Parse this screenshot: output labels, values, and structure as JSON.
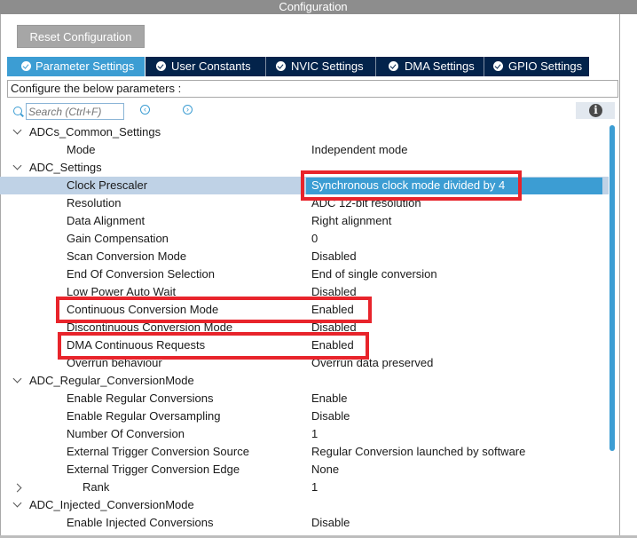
{
  "window": {
    "title": "Configuration"
  },
  "toolbar": {
    "reset_label": "Reset Configuration"
  },
  "tabs": [
    {
      "label": "Parameter Settings",
      "active": true
    },
    {
      "label": "User Constants",
      "active": false
    },
    {
      "label": "NVIC Settings",
      "active": false
    },
    {
      "label": "DMA Settings",
      "active": false
    },
    {
      "label": "GPIO Settings",
      "active": false
    }
  ],
  "configure_text": "Configure the below parameters :",
  "search": {
    "placeholder": "Search (Ctrl+F)"
  },
  "colors": {
    "accent": "#3c9dd3",
    "tab_bar": "#03234b",
    "highlight": "#e8242b",
    "selected_row": "#bfd2e6"
  },
  "rows": [
    {
      "label": "ADCs_Common_Settings",
      "value": "",
      "type": "group",
      "expanded": true
    },
    {
      "label": "Mode",
      "value": "Independent mode",
      "type": "param"
    },
    {
      "label": "ADC_Settings",
      "value": "",
      "type": "group",
      "expanded": true
    },
    {
      "label": "Clock Prescaler",
      "value": "Synchronous clock mode divided by 4",
      "type": "param",
      "selected": true
    },
    {
      "label": "Resolution",
      "value": "ADC 12-bit resolution",
      "type": "param"
    },
    {
      "label": "Data Alignment",
      "value": "Right alignment",
      "type": "param"
    },
    {
      "label": "Gain Compensation",
      "value": "0",
      "type": "param"
    },
    {
      "label": "Scan Conversion Mode",
      "value": "Disabled",
      "type": "param"
    },
    {
      "label": "End Of Conversion Selection",
      "value": "End of single conversion",
      "type": "param"
    },
    {
      "label": "Low Power Auto Wait",
      "value": "Disabled",
      "type": "param"
    },
    {
      "label": "Continuous Conversion Mode",
      "value": "Enabled",
      "type": "param"
    },
    {
      "label": "Discontinuous Conversion Mode",
      "value": "Disabled",
      "type": "param"
    },
    {
      "label": "DMA Continuous Requests",
      "value": "Enabled",
      "type": "param"
    },
    {
      "label": "Overrun behaviour",
      "value": "Overrun data preserved",
      "type": "param"
    },
    {
      "label": "ADC_Regular_ConversionMode",
      "value": "",
      "type": "group",
      "expanded": true
    },
    {
      "label": "Enable Regular Conversions",
      "value": "Enable",
      "type": "param"
    },
    {
      "label": "Enable Regular Oversampling",
      "value": "Disable",
      "type": "param"
    },
    {
      "label": "Number Of Conversion",
      "value": "1",
      "type": "param"
    },
    {
      "label": "External Trigger Conversion Source",
      "value": "Regular Conversion launched by software",
      "type": "param"
    },
    {
      "label": "External Trigger Conversion Edge",
      "value": "None",
      "type": "param"
    },
    {
      "label": "Rank",
      "value": "1",
      "type": "subgroup",
      "expanded": false
    },
    {
      "label": "ADC_Injected_ConversionMode",
      "value": "",
      "type": "group",
      "expanded": true
    },
    {
      "label": "Enable Injected Conversions",
      "value": "Disable",
      "type": "param"
    }
  ]
}
